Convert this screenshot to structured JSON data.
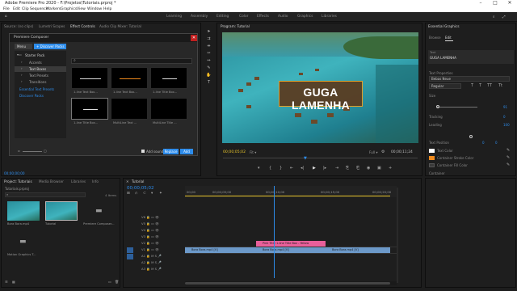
{
  "app": {
    "title": "Adobe Premiere Pro 2020 - F:\\Projetos\\Tutoriais.prproj *"
  },
  "menu": [
    "File",
    "Edit",
    "Clip",
    "Sequence",
    "Markers",
    "Graphics",
    "View",
    "Window",
    "Help"
  ],
  "workspaces": [
    "Learning",
    "Assembly",
    "Editing",
    "Color",
    "Effects",
    "Audio",
    "Graphics",
    "Libraries"
  ],
  "source_tabs": [
    "Source: (no clips)",
    "Lumetri Scopes",
    "Effect Controls",
    "Audio Clip Mixer: Tutorial"
  ],
  "dialog": {
    "title": "Premiere Composer",
    "menu_label": "Menu",
    "discover_label": "+ Discover Packs",
    "search_placeholder": "",
    "tree": [
      "Starter Pack",
      "Accents",
      "Text Boxes",
      "Text Presets",
      "Transitions"
    ],
    "tree_links": [
      "Essential Text Presets",
      "Discover Packs"
    ],
    "thumbs": [
      "1-line Text Box...",
      "1-line Text Box...",
      "1-line Title Box...",
      "1-line Title Box...",
      "MultiLine Text ...",
      "MultiLine Title ..."
    ],
    "add_sound": "Add sound",
    "replace": "Replace",
    "add": "Add"
  },
  "source_timecode": "00;00;00;00",
  "program": {
    "tab": "Program: Tutorial",
    "overlay_title": "GUGA LAMENHA",
    "timecode": "00;00;05;02",
    "fit": "Fit",
    "zoom": "Full",
    "duration": "00;00;11;24"
  },
  "project": {
    "tabs": [
      "Project: Tutoriais",
      "Media Browser",
      "Libraries",
      "Info"
    ],
    "file": "Tutoriais.prproj",
    "count": "4 Items",
    "items": [
      "Bora Bora.mp4",
      "Tutorial",
      "Premiere Composer...",
      "Motion Graphics T..."
    ]
  },
  "timeline": {
    "tab": "Tutorial",
    "timecode": "00;00;05;02",
    "ruler": [
      "00;00",
      "00;00;05;00",
      "00;00;10;00",
      "00;00;15;00",
      "00;00;20;00"
    ],
    "tracks": [
      "V6",
      "V5",
      "V4",
      "V3",
      "V2",
      "V1",
      "A1",
      "A2",
      "A3"
    ],
    "clips": {
      "graphic": "Pink Title 1-line Title Box - Yellow",
      "v1a": "Bora Bora.mp4 [V]",
      "v1b": "Bora Bora.mp4 [V]",
      "v1c": "Bora Bora.mp4 [V]"
    }
  },
  "essential_graphics": {
    "tab": "Essential Graphics",
    "subtabs": [
      "Browse",
      "Edit"
    ],
    "layer_text": "GUGA LAMENHA",
    "section_text": "Text",
    "align_label": "Text Properties",
    "font": "Bebas Neue",
    "style": "Regular",
    "size_label": "Size",
    "size_val": "91",
    "tracking_label": "Tracking",
    "tracking_val": "0",
    "fill_label": "Fill",
    "leading_label": "Leading",
    "leading_val": "100",
    "text_position": "Text Position",
    "pos_x": "0",
    "pos_y": "0",
    "color_labels": [
      "Text Color",
      "Container Stroke Color",
      "Container Fill Color"
    ],
    "container_label": "Container",
    "colors": {
      "white": "#ffffff",
      "orange": "#f08a1c",
      "dark": "#3a3a3a"
    }
  },
  "colors": {
    "accent": "#2d8ceb",
    "graphic_clip": "#e85f9a",
    "video_clip": "#6c99c9",
    "overlay_bg": "#5b3a1e",
    "overlay_border": "#f0a020"
  }
}
